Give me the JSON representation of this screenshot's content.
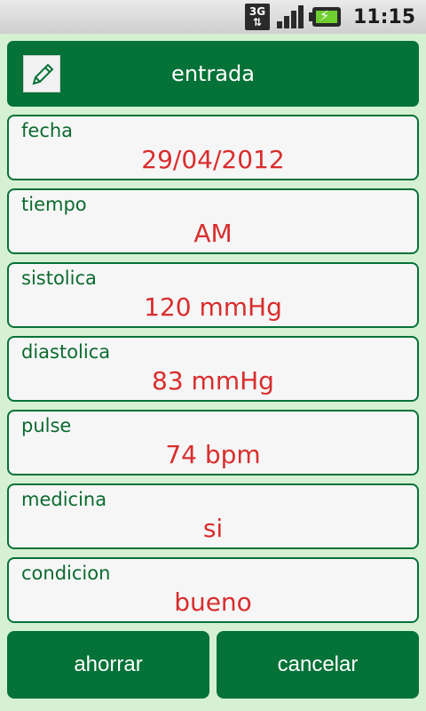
{
  "status_bar": {
    "network": "3G",
    "time": "11:15"
  },
  "header": {
    "title": "entrada",
    "icon": "pencil-edit-icon"
  },
  "fields": [
    {
      "label": "fecha",
      "value": "29/04/2012"
    },
    {
      "label": "tiempo",
      "value": "AM"
    },
    {
      "label": "sistolica",
      "value": "120 mmHg"
    },
    {
      "label": "diastolica",
      "value": "83 mmHg"
    },
    {
      "label": "pulse",
      "value": "74 bpm"
    },
    {
      "label": "medicina",
      "value": "si"
    },
    {
      "label": "condicion",
      "value": "bueno"
    }
  ],
  "buttons": {
    "save": "ahorrar",
    "cancel": "cancelar"
  },
  "colors": {
    "primary": "#057237",
    "value": "#d92d2d",
    "label": "#0c6a2f",
    "background": "#d6f0d3"
  }
}
